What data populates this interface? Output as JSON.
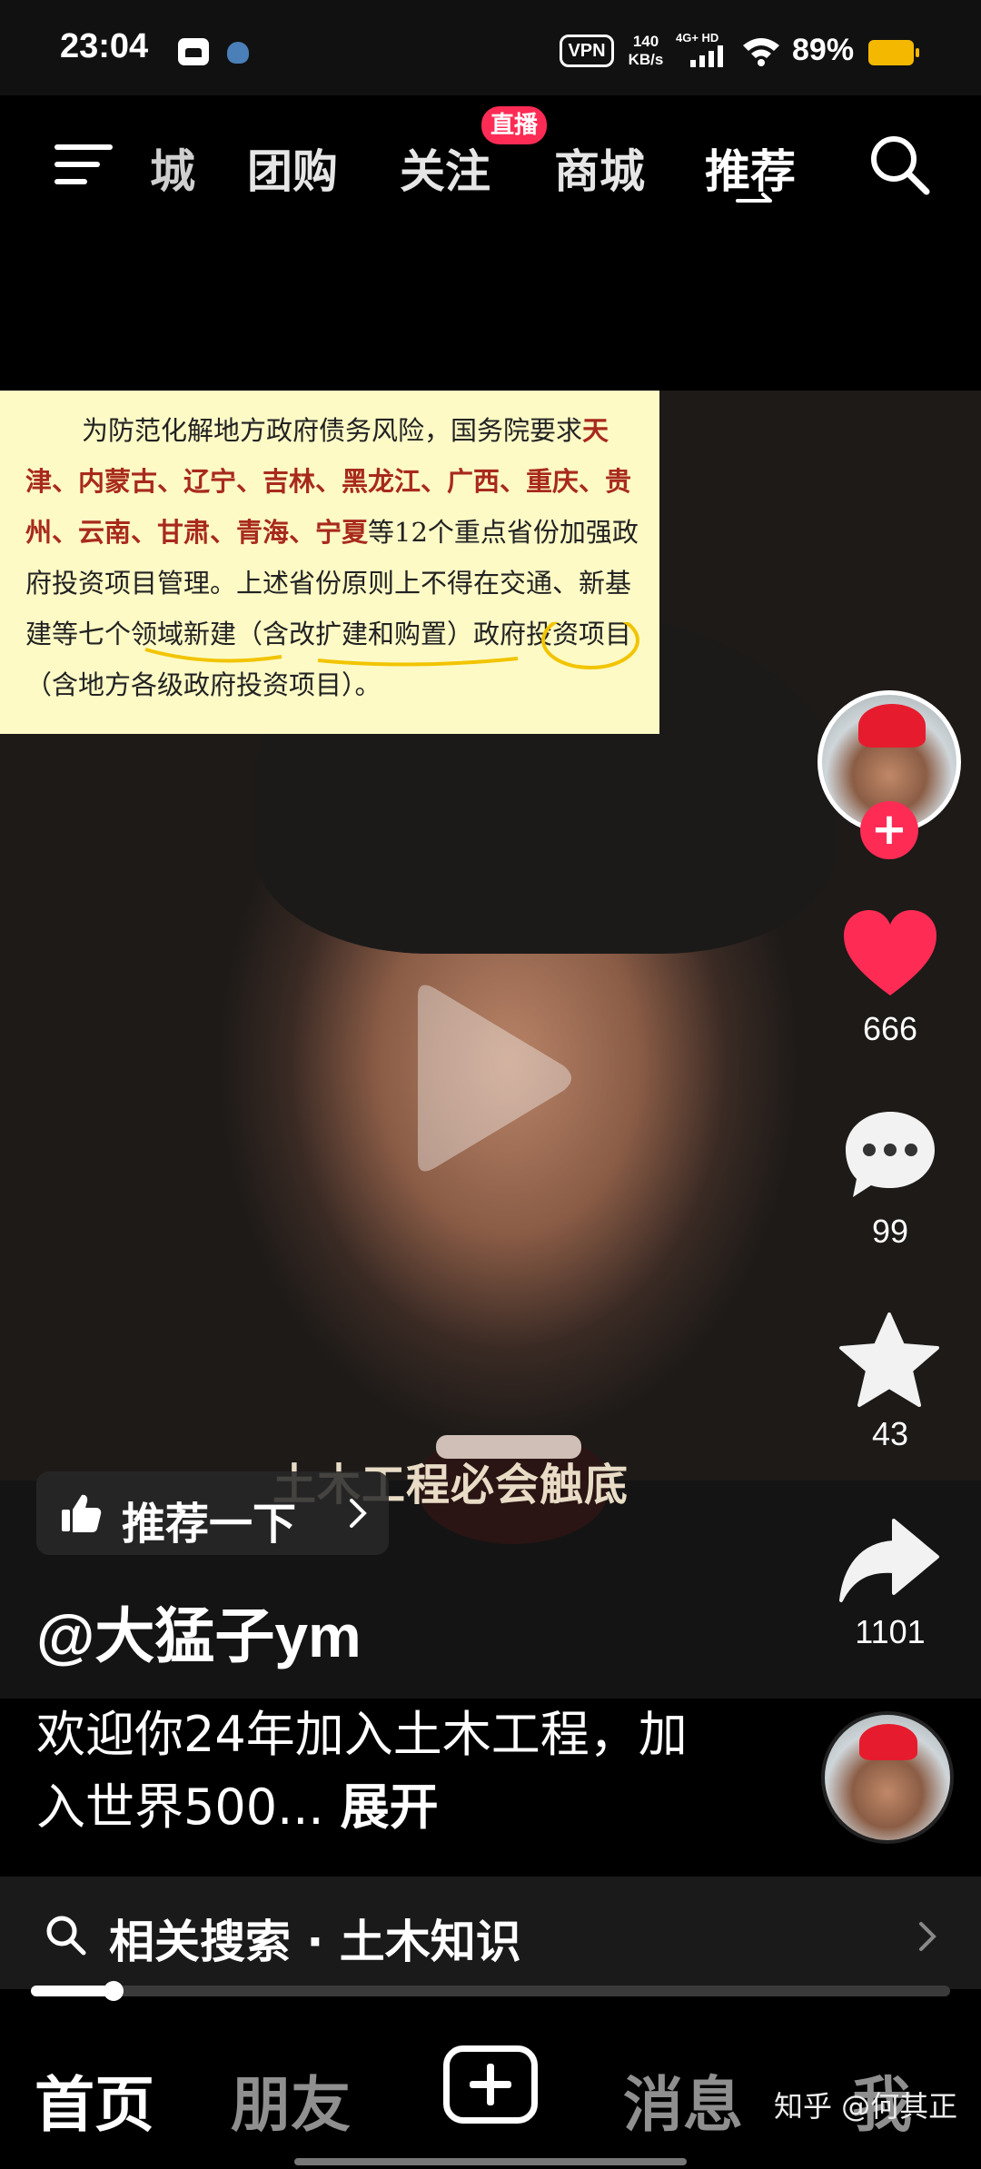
{
  "status_bar": {
    "time": "23:04",
    "vpn_label": "VPN",
    "speed_value": "140",
    "speed_unit": "KB/s",
    "network_label": "4G+ HD",
    "battery_percent": "89%",
    "battery_color": "#f5b800"
  },
  "top_nav": {
    "tabs": [
      {
        "label": "城",
        "full_label": "商城"
      },
      {
        "label": "团购"
      },
      {
        "label": "关注"
      },
      {
        "label": "商城"
      },
      {
        "label": "推荐"
      }
    ],
    "active_tab": "推荐",
    "live_badge": "直播",
    "icons": [
      "menu-icon",
      "search-icon",
      "switch-icon"
    ]
  },
  "video": {
    "document_text": [
      {
        "text": "为防范化解地方政府债务风险，国务院要求",
        "hl": false
      },
      {
        "text": "天津、内蒙古、辽宁、吉林、黑龙江、广西、重庆、贵州、云南、甘肃、青海、宁夏",
        "hl": true
      },
      {
        "text": "等12个重点省份加强政府投资项目管理。上述省份原则上不得在交通、新基建等七个领域新建（含改扩建和购置）政府投资项目（含地方各级政府投资项目）。",
        "hl": false
      }
    ],
    "caption": "土木工程必会触底",
    "play_icon": "play-icon"
  },
  "right_rail": {
    "likes": "666",
    "comments": "99",
    "favorites": "43",
    "shares": "1101",
    "like_color": "#fe2c55"
  },
  "recommend_pill": {
    "label": "推荐一下"
  },
  "author": {
    "name": "@大猛子ym"
  },
  "description": {
    "text": "欢迎你24年加入土木工程，加入世界500...",
    "expand_label": "展开"
  },
  "related_search": {
    "label": "相关搜索 · 土木知识"
  },
  "progress": {
    "fraction": 0.09
  },
  "bottom_nav": {
    "home": "首页",
    "friends": "朋友",
    "messages": "消息",
    "me": "我",
    "watermark": "知乎 @何其正"
  }
}
